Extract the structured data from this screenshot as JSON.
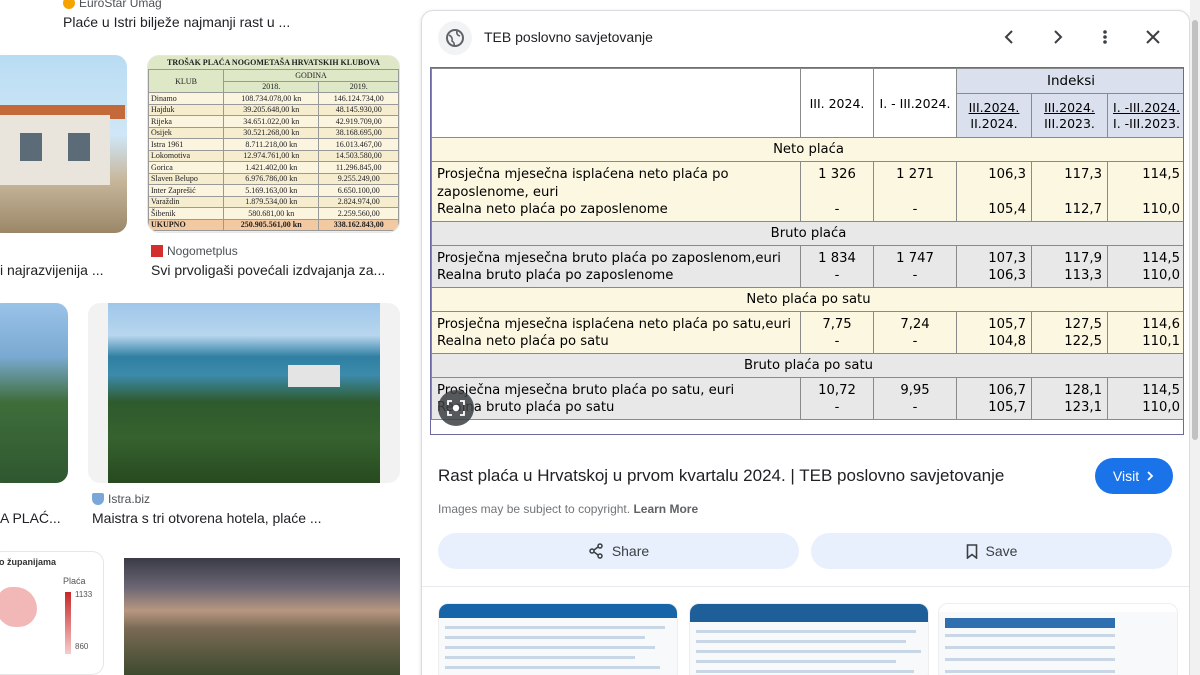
{
  "left_grid": {
    "top_source": "EuroStar Umag",
    "top_title": "Plaće u Istri bilježe najmanji rast u ...",
    "row1": {
      "left_title": "i najrazvijenija ...",
      "right_source": "Nogometplus",
      "right_title": "Svi prvoligaši povećali izdvajanja za..."
    },
    "cost_table": {
      "title": "TROŠAK PLAĆA NOGOMETAŠA HRVATSKIH KLUBOVA",
      "col_club": "KLUB",
      "col_group": "GODINA",
      "years": [
        "2018.",
        "2019."
      ],
      "rows": [
        [
          "Dinamo",
          "108.734.078,00 kn",
          "146.124.734,00"
        ],
        [
          "Hajduk",
          "39.205.648,00 kn",
          "48.145.930,00"
        ],
        [
          "Rijeka",
          "34.651.022,00 kn",
          "42.919.709,00"
        ],
        [
          "Osijek",
          "30.521.268,00 kn",
          "38.168.695,00"
        ],
        [
          "Istra 1961",
          "8.711.218,00 kn",
          "16.013.467,00"
        ],
        [
          "Lokomotiva",
          "12.974.761,00 kn",
          "14.503.580,00"
        ],
        [
          "Gorica",
          "1.421.402,00 kn",
          "11.296.845,00"
        ],
        [
          "Slaven Belupo",
          "6.976.786,00 kn",
          "9.255.249,00"
        ],
        [
          "Inter Zaprešić",
          "5.169.163,00 kn",
          "6.650.100,00"
        ],
        [
          "Varaždin",
          "1.879.534,00 kn",
          "2.824.974,00"
        ],
        [
          "Šibenik",
          "580.681,00 kn",
          "2.259.560,00"
        ]
      ],
      "total": [
        "UKUPNO",
        "250.905.561,00 kn",
        "338.162.843,00"
      ]
    },
    "row2": {
      "left_title": "A PLAĆ...",
      "right_source": "Istra.biz",
      "right_title": "Maistra s tri otvorena hotela, plaće ..."
    },
    "map": {
      "title": "o županijama",
      "legend": "Plaća",
      "max": "1133",
      "min": "860"
    }
  },
  "panel": {
    "site_name": "TEB poslovno savjetovanje",
    "result_title": "Rast plaća u Hrvatskoj u prvom kvartalu 2024. | TEB poslovno savjetovanje",
    "visit_label": "Visit",
    "copyright_text": "Images may be subject to copyright.",
    "learn_more": "Learn More",
    "share_label": "Share",
    "save_label": "Save"
  },
  "stat_table": {
    "col1": "III. 2024.",
    "col2": "I. - III.2024.",
    "indeksi": "Indeksi",
    "idx1_top": "III.2024.",
    "idx1_bot": "II.2024.",
    "idx2_top": "III.2024.",
    "idx2_bot": "III.2023.",
    "idx3_top": "I. -III.2024.",
    "idx3_bot": "I. -III.2023.",
    "sections": [
      {
        "name": "Neto plaća",
        "rows": [
          {
            "label": "Prosječna mjesečna isplaćena neto plaća po zaposlenome, euri",
            "v1": "1 326",
            "v2": "1 271",
            "i1": "106,3",
            "i2": "117,3",
            "i3": "114,5"
          },
          {
            "label": "Realna neto plaća po zaposlenome",
            "v1": "-",
            "v2": "-",
            "i1": "105,4",
            "i2": "112,7",
            "i3": "110,0"
          }
        ]
      },
      {
        "name": "Bruto plaća",
        "rows": [
          {
            "label": "Prosječna mjesečna bruto plaća po zaposlenom,euri",
            "v1": "1 834",
            "v2": "1 747",
            "i1": "107,3",
            "i2": "117,9",
            "i3": "114,5"
          },
          {
            "label": "Realna bruto plaća po zaposlenome",
            "v1": "-",
            "v2": "-",
            "i1": "106,3",
            "i2": "113,3",
            "i3": "110,0"
          }
        ]
      },
      {
        "name": "Neto plaća po satu",
        "rows": [
          {
            "label": "Prosječna mjesečna isplaćena neto plaća po satu,euri",
            "v1": "7,75",
            "v2": "7,24",
            "i1": "105,7",
            "i2": "127,5",
            "i3": "114,6"
          },
          {
            "label": "Realna neto plaća po satu",
            "v1": "-",
            "v2": "-",
            "i1": "104,8",
            "i2": "122,5",
            "i3": "110,1"
          }
        ]
      },
      {
        "name": "Bruto plaća po satu",
        "rows": [
          {
            "label": "Prosječna mjesečna bruto plaća po satu, euri",
            "v1": "10,72",
            "v2": "9,95",
            "i1": "106,7",
            "i2": "128,1",
            "i3": "114,5"
          },
          {
            "label": "Realna bruto plaća po satu",
            "v1": "-",
            "v2": "-",
            "i1": "105,7",
            "i2": "123,1",
            "i3": "110,0"
          }
        ]
      }
    ]
  },
  "colors": {
    "accent": "#1a73e8",
    "action_bg": "#e8f0fe",
    "table_header": "#dbe0ee",
    "table_cream": "#fcf7e0",
    "table_grey": "#e8e8e8"
  }
}
